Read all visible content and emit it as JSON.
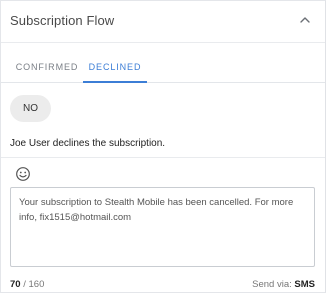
{
  "panel": {
    "title": "Subscription Flow",
    "collapse_icon": "chevron-up-icon"
  },
  "tabs": [
    {
      "label": "CONFIRMED",
      "active": false
    },
    {
      "label": "DECLINED",
      "active": true
    }
  ],
  "conversation": {
    "reply": "NO",
    "event": "Joe User declines the subscription."
  },
  "composer": {
    "emoji_icon": "smiley-icon",
    "message": "Your subscription to Stealth Mobile has been cancelled. For more info, fix1515@hotmail.com",
    "count_used": "70",
    "count_sep": " / ",
    "count_max": "160",
    "send_via_label": "Send via: ",
    "send_via_channel": "SMS"
  },
  "colors": {
    "accent": "#3c7ed6",
    "bubble": "#ececec",
    "border": "#c9cdd2"
  }
}
